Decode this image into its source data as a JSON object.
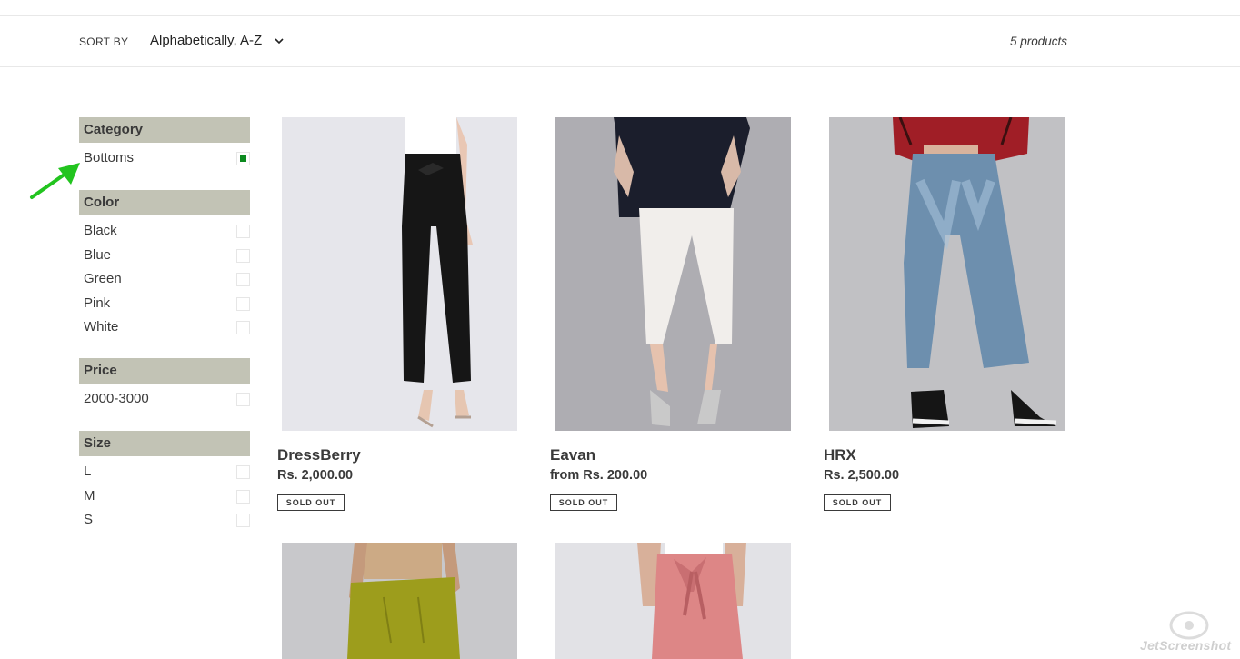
{
  "sort": {
    "label": "SORT BY",
    "value": "Alphabetically, A-Z",
    "count": "5 products"
  },
  "filters": {
    "category": {
      "heading": "Category",
      "options": [
        {
          "label": "Bottoms",
          "checked": true
        }
      ]
    },
    "color": {
      "heading": "Color",
      "options": [
        {
          "label": "Black"
        },
        {
          "label": "Blue"
        },
        {
          "label": "Green"
        },
        {
          "label": "Pink"
        },
        {
          "label": "White"
        }
      ]
    },
    "price": {
      "heading": "Price",
      "options": [
        {
          "label": "2000-3000"
        }
      ]
    },
    "size": {
      "heading": "Size",
      "options": [
        {
          "label": "L"
        },
        {
          "label": "M"
        },
        {
          "label": "S"
        }
      ]
    }
  },
  "products": [
    {
      "title": "DressBerry",
      "price": "Rs. 2,000.00",
      "badge": "SOLD OUT"
    },
    {
      "title": "Eavan",
      "price": "from Rs. 200.00",
      "badge": "SOLD OUT"
    },
    {
      "title": "HRX",
      "price": "Rs. 2,500.00",
      "badge": "SOLD OUT"
    }
  ],
  "colors": {
    "filter_heading_bg": "#c2c3b5",
    "checked_green": "#0c8a1f",
    "annotation_arrow": "#22c41f"
  },
  "watermark": {
    "text": "JetScreenshot"
  }
}
